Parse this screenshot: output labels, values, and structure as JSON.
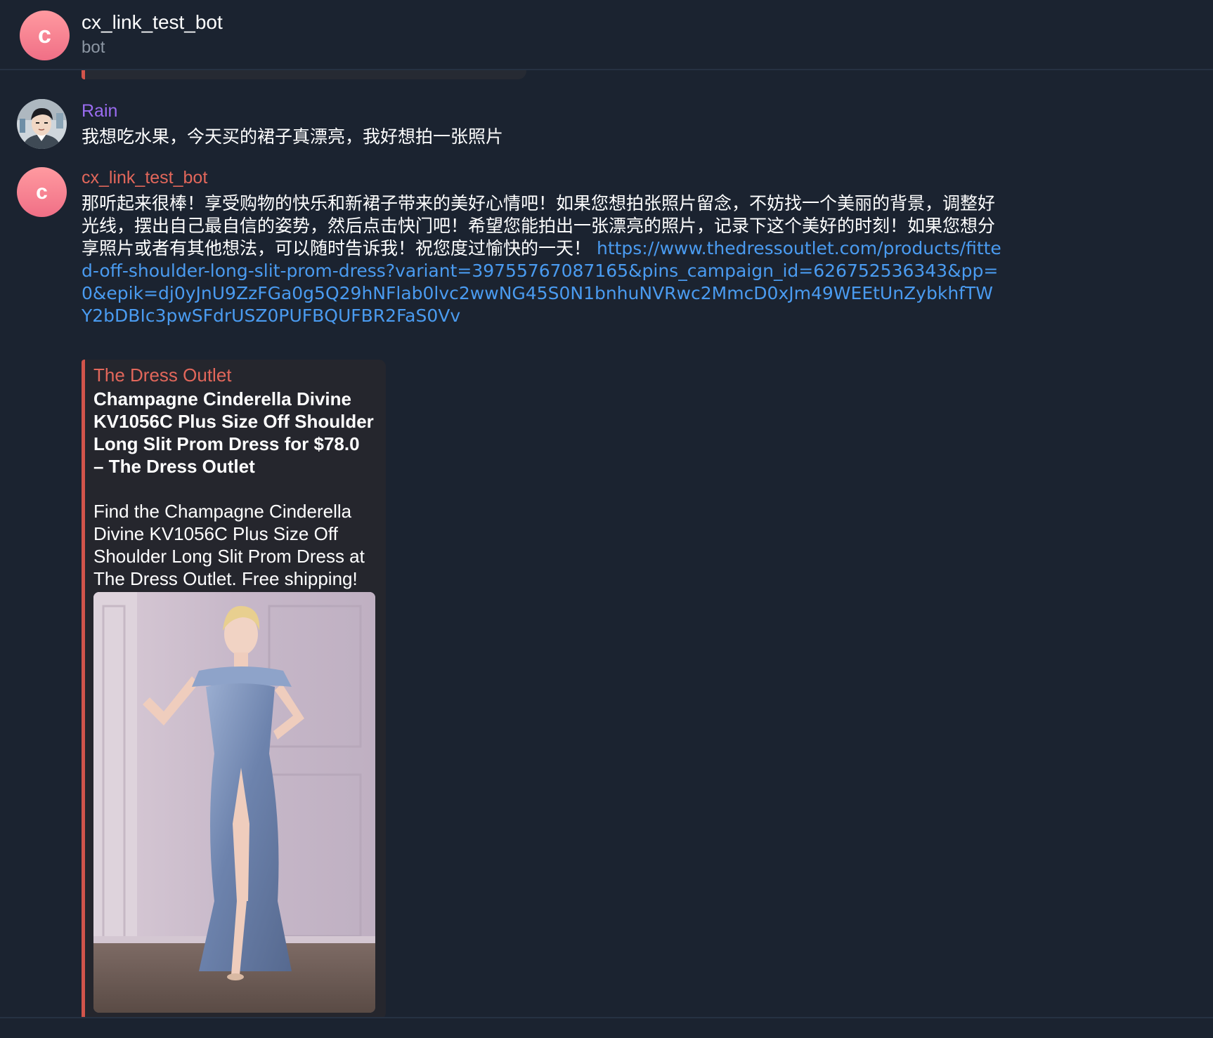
{
  "header": {
    "avatar_letter": "c",
    "title": "cx_link_test_bot",
    "subtitle": "bot"
  },
  "colors": {
    "accent": "#d2544b",
    "link": "#4a9bf0",
    "user_name": "#9a6cf0",
    "bot_name": "#e2675b",
    "background": "#1b2330"
  },
  "messages": [
    {
      "sender": "Rain",
      "avatar": "user-avatar",
      "text": "我想吃水果，今天买的裙子真漂亮，我好想拍一张照片"
    },
    {
      "sender": "cx_link_test_bot",
      "avatar_letter": "c",
      "text": "那听起来很棒！享受购物的快乐和新裙子带来的美好心情吧！如果您想拍张照片留念，不妨找一个美丽的背景，调整好光线，摆出自己最自信的姿势，然后点击快门吧！希望您能拍出一张漂亮的照片，记录下这个美好的时刻！如果您想分享照片或者有其他想法，可以随时告诉我！祝您度过愉快的一天！",
      "link": "https://www.thedressoutlet.com/products/fitted-off-shoulder-long-slit-prom-dress?variant=39755767087165&pins_campaign_id=626752536343&pp=0&epik=dj0yJnU9ZzFGa0g5Q29hNFlab0lvc2wwNG45S0N1bnhuNVRwc2MmcD0xJm49WEEtUnZybkhfTWY2bDBIc3pwSFdrUSZ0PUFBQUFBR2FaS0Vv",
      "preview": {
        "site_name": "The Dress Outlet",
        "title_line1": "Champagne Cinderella Divine KV1056C Plus Size Off Shoulder Long Slit Prom Dress for $78.0",
        "title_line2": " – The Dress Outlet",
        "description": "Find the Champagne Cinderella Divine KV1056C Plus Size Off Shoulder Long Slit Prom Dress at The Dress Outlet. Free shipping!",
        "image": "dress-photo"
      }
    }
  ]
}
